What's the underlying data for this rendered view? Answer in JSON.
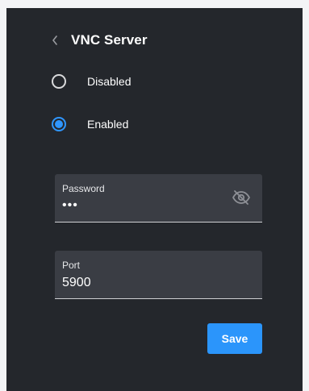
{
  "header": {
    "title": "VNC Server",
    "back_icon": "chevron-left-icon"
  },
  "mode": {
    "options": [
      {
        "label": "Disabled",
        "selected": false
      },
      {
        "label": "Enabled",
        "selected": true
      }
    ]
  },
  "password": {
    "label": "Password",
    "value": "•••",
    "toggle_icon": "eye-off-icon"
  },
  "port": {
    "label": "Port",
    "value": "5900"
  },
  "actions": {
    "save_label": "Save"
  },
  "colors": {
    "accent": "#2b95fb",
    "panel_bg": "#24272c",
    "field_bg": "#3a3d44"
  }
}
